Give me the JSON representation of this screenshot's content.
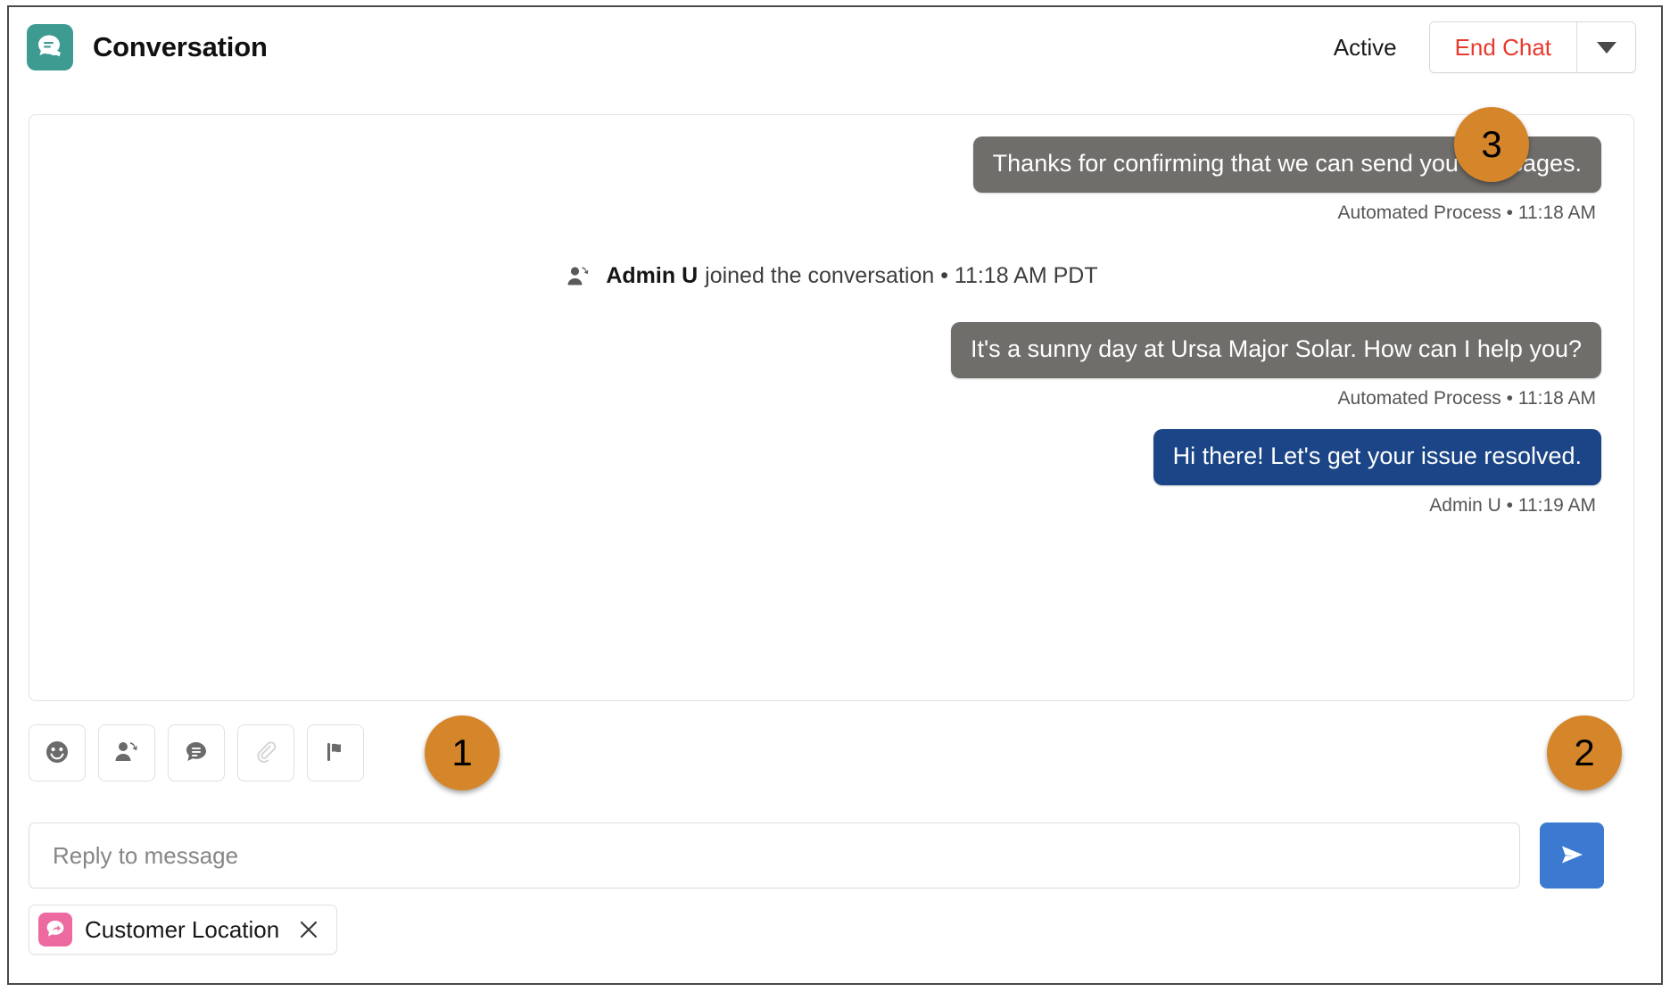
{
  "header": {
    "app_icon": "conversation-chat-icon",
    "title": "Conversation",
    "status": "Active",
    "end_chat_label": "End Chat",
    "dropdown_icon": "chevron-down-icon",
    "end_chat_color": "#e8392e"
  },
  "conversation": {
    "messages": [
      {
        "text": "Thanks for confirming that we can send you messages.",
        "meta": "Automated Process • 11:18 AM",
        "type": "automated",
        "color": "#706e6b"
      },
      {
        "type": "system",
        "icon": "person-joined-icon",
        "who": "Admin U",
        "text": "joined the conversation • 11:18 AM PDT"
      },
      {
        "text": "It's a sunny day at Ursa Major Solar. How can I help you?",
        "meta": "Automated Process • 11:18 AM",
        "type": "automated",
        "color": "#706e6b"
      },
      {
        "text": "Hi there! Let's get your issue resolved.",
        "meta": "Admin U • 11:19 AM",
        "type": "agent",
        "color": "#1b4586"
      }
    ]
  },
  "toolbar": {
    "buttons": [
      {
        "name": "emoji-icon",
        "label": "Emoji",
        "disabled": false
      },
      {
        "name": "transfer-conversation-icon",
        "label": "Transfer",
        "disabled": false
      },
      {
        "name": "quick-text-icon",
        "label": "Quick Text",
        "disabled": false
      },
      {
        "name": "attachment-icon",
        "label": "Attachment",
        "disabled": true
      },
      {
        "name": "flag-icon",
        "label": "Raise Flag",
        "disabled": false
      }
    ]
  },
  "composer": {
    "placeholder": "Reply to message",
    "value": "",
    "send_icon": "send-paper-plane-icon",
    "send_color": "#3b7ad0"
  },
  "chip": {
    "icon": "customer-location-icon",
    "icon_color": "#ec6aa0",
    "label": "Customer Location",
    "close_icon": "close-x-icon"
  },
  "callouts": [
    {
      "number": "1",
      "color": "#d6862a"
    },
    {
      "number": "2",
      "color": "#d6862a"
    },
    {
      "number": "3",
      "color": "#d6862a"
    }
  ]
}
